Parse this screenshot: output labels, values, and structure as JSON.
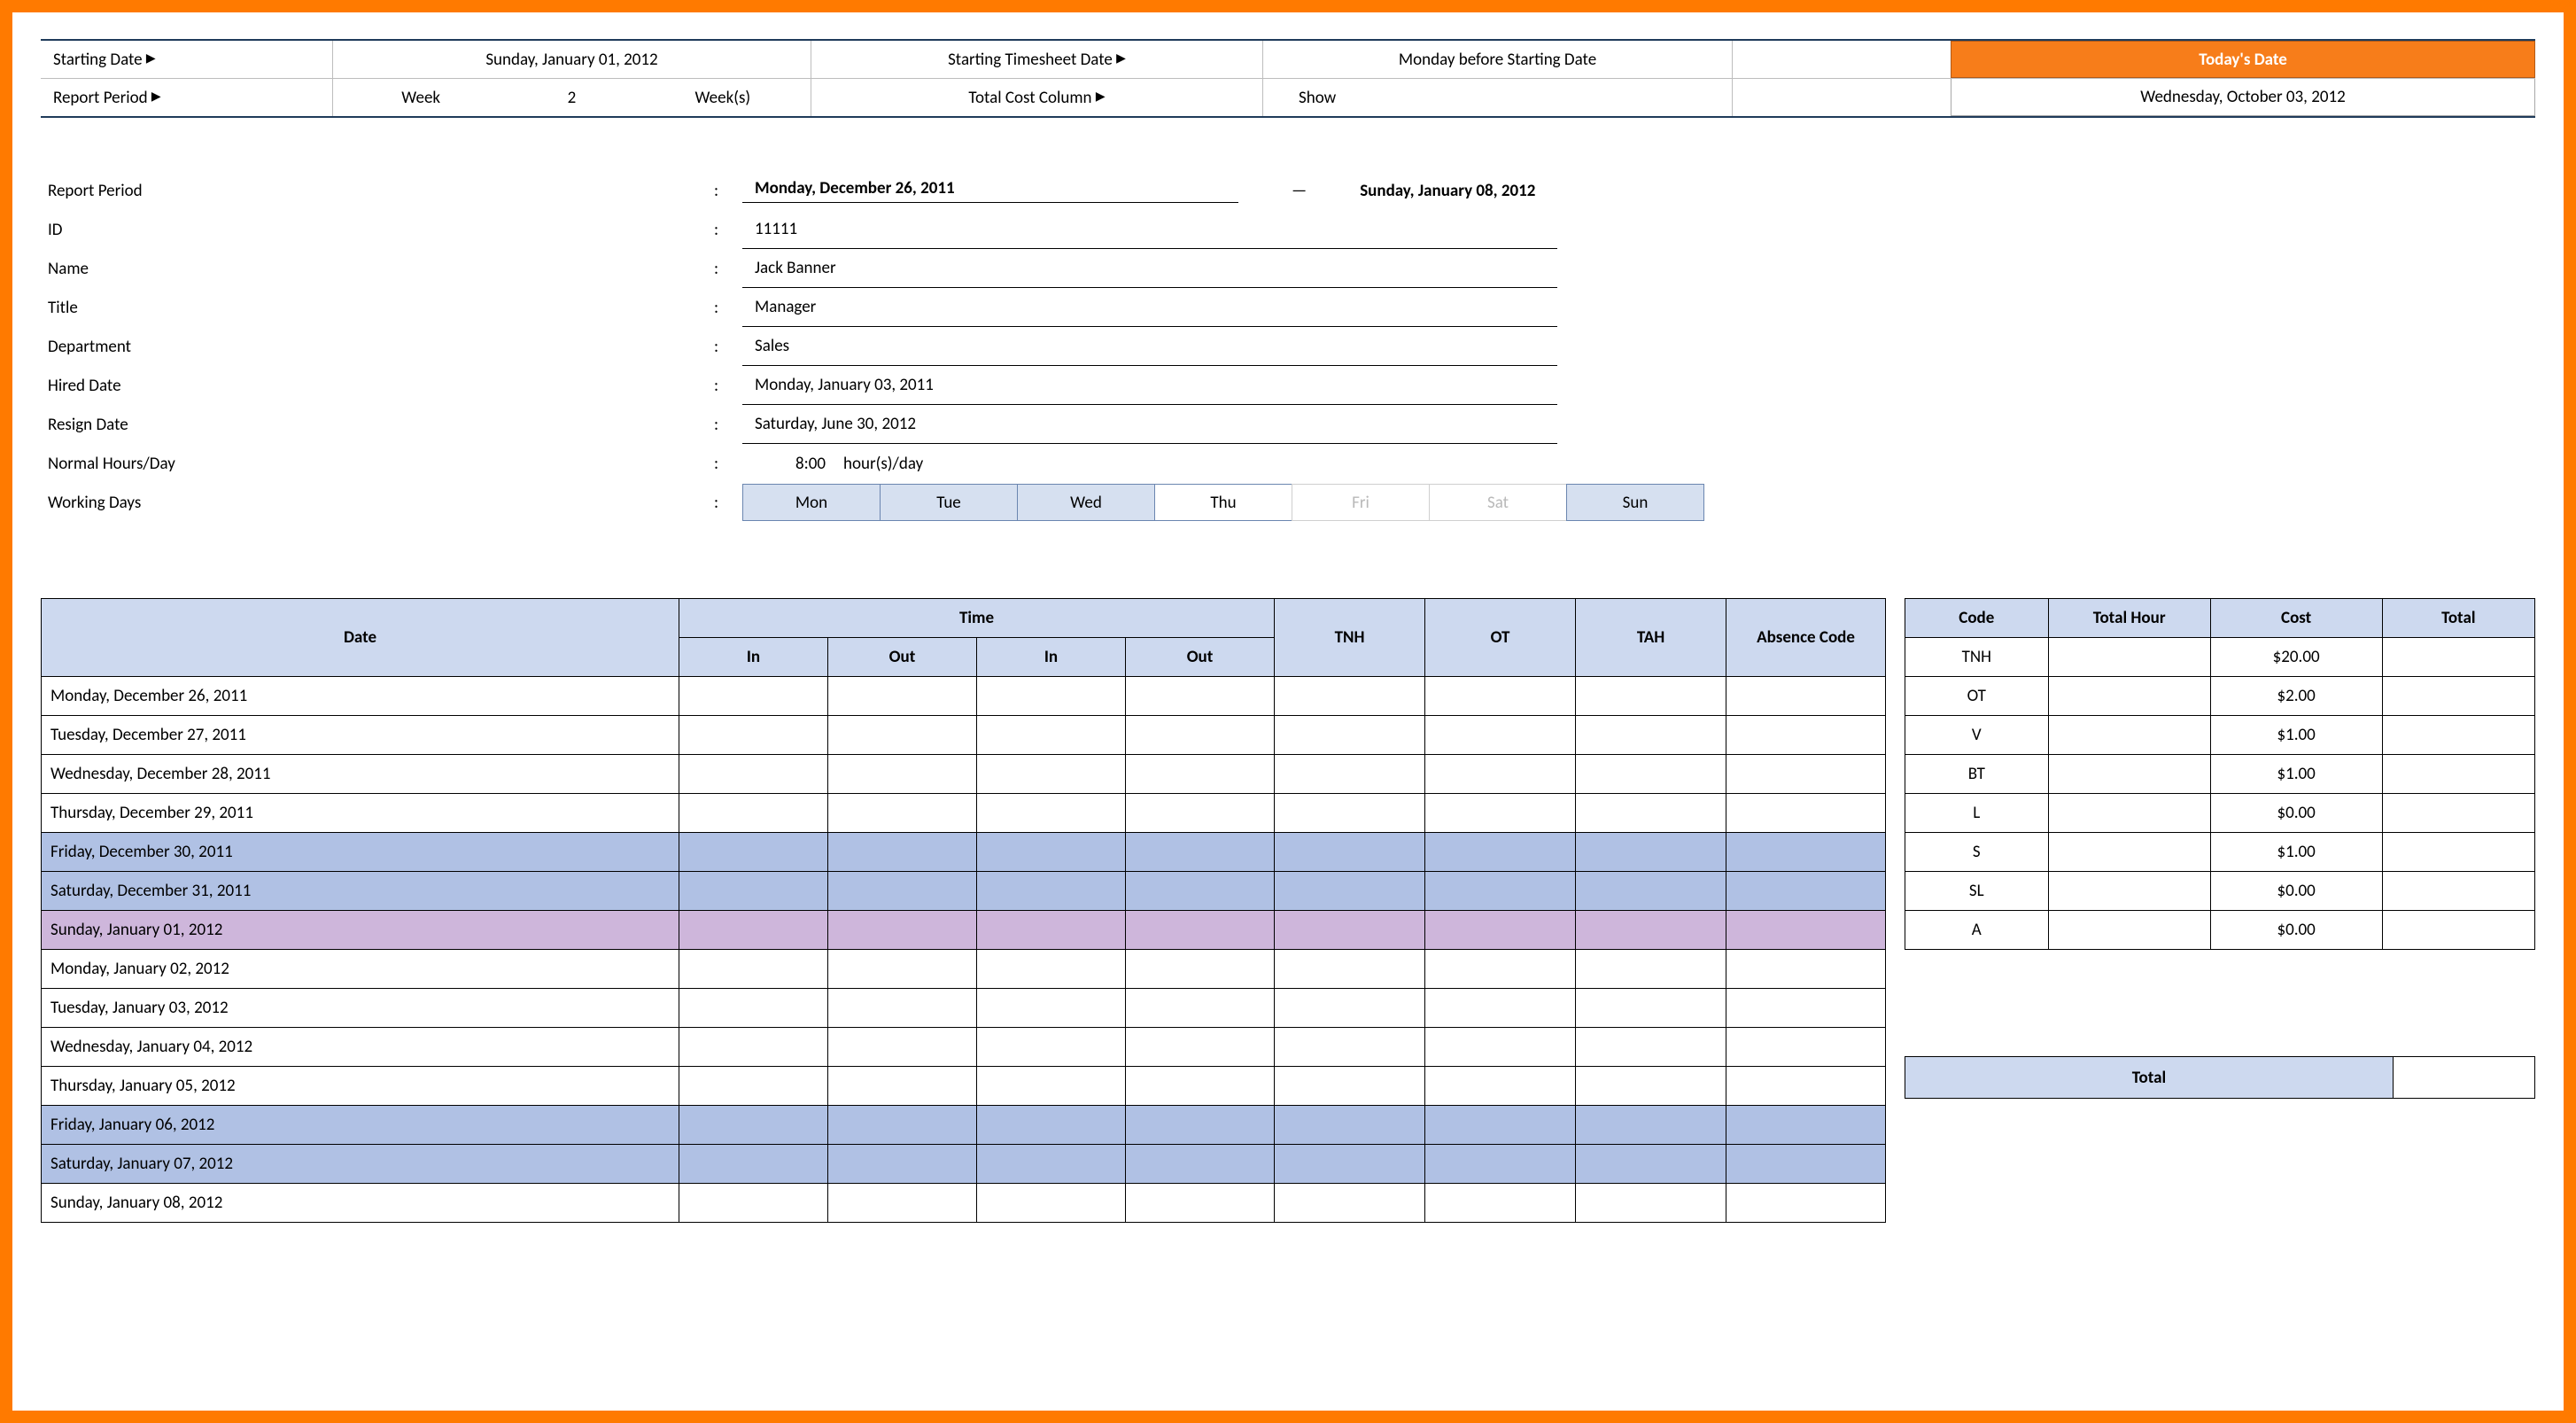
{
  "controls": {
    "starting_date_label": "Starting Date",
    "starting_date_value": "Sunday, January 01, 2012",
    "starting_ts_label": "Starting Timesheet Date",
    "starting_ts_value": "Monday before Starting Date",
    "report_period_label": "Report Period",
    "report_period_unit": "Week",
    "report_period_qty": "2",
    "report_period_suffix": "Week(s)",
    "total_cost_label": "Total Cost Column",
    "total_cost_value": "Show"
  },
  "today": {
    "header": "Today's Date",
    "value": "Wednesday, October 03, 2012"
  },
  "info": {
    "report_period_label": "Report Period",
    "period_from": "Monday, December 26, 2011",
    "period_to": "Sunday, January 08, 2012",
    "id_label": "ID",
    "id_value": "11111",
    "name_label": "Name",
    "name_value": "Jack Banner",
    "title_label": "Title",
    "title_value": "Manager",
    "dept_label": "Department",
    "dept_value": "Sales",
    "hired_label": "Hired Date",
    "hired_value": "Monday, January 03, 2011",
    "resign_label": "Resign Date",
    "resign_value": "Saturday, June 30, 2012",
    "hours_label": "Normal Hours/Day",
    "hours_value": "8:00",
    "hours_unit": "hour(s)/day",
    "working_days_label": "Working Days",
    "days": {
      "mon": "Mon",
      "tue": "Tue",
      "wed": "Wed",
      "thu": "Thu",
      "fri": "Fri",
      "sat": "Sat",
      "sun": "Sun"
    }
  },
  "ts_headers": {
    "date": "Date",
    "time": "Time",
    "in": "In",
    "out": "Out",
    "tnh": "TNH",
    "ot": "OT",
    "tah": "TAH",
    "absence": "Absence Code"
  },
  "ts_rows": {
    "r0": "Monday, December 26, 2011",
    "r1": "Tuesday, December 27, 2011",
    "r2": "Wednesday, December 28, 2011",
    "r3": "Thursday, December 29, 2011",
    "r4": "Friday, December 30, 2011",
    "r5": "Saturday, December 31, 2011",
    "r6": "Sunday, January 01, 2012",
    "r7": "Monday, January 02, 2012",
    "r8": "Tuesday, January 03, 2012",
    "r9": "Wednesday, January 04, 2012",
    "r10": "Thursday, January 05, 2012",
    "r11": "Friday, January 06, 2012",
    "r12": "Saturday, January 07, 2012",
    "r13": "Sunday, January 08, 2012"
  },
  "code_headers": {
    "code": "Code",
    "total_hour": "Total Hour",
    "cost": "Cost",
    "total": "Total"
  },
  "code_rows": {
    "r0": {
      "code": "TNH",
      "cost": "$20.00"
    },
    "r1": {
      "code": "OT",
      "cost": "$2.00"
    },
    "r2": {
      "code": "V",
      "cost": "$1.00"
    },
    "r3": {
      "code": "BT",
      "cost": "$1.00"
    },
    "r4": {
      "code": "L",
      "cost": "$0.00"
    },
    "r5": {
      "code": "S",
      "cost": "$1.00"
    },
    "r6": {
      "code": "SL",
      "cost": "$0.00"
    },
    "r7": {
      "code": "A",
      "cost": "$0.00"
    }
  },
  "totals": {
    "label": "Total"
  }
}
